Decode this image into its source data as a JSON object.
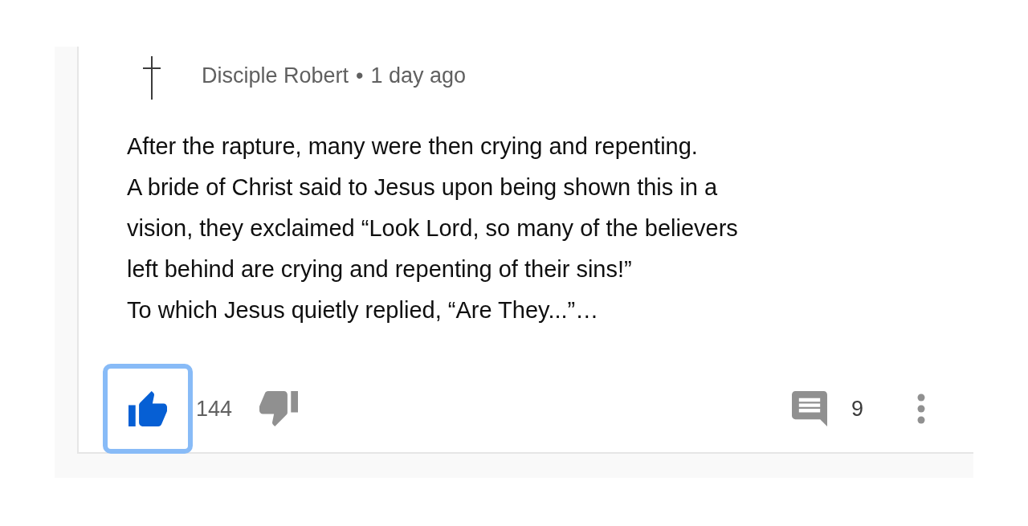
{
  "comment": {
    "author": "Disciple Robert",
    "separator": "•",
    "time": "1 day ago",
    "body_lines": [
      "After the rapture, many were then crying and repenting.",
      "A bride of Christ said to Jesus upon being shown this in a",
      "vision, they exclaimed “Look Lord, so many of the believers",
      "left behind are crying and repenting of their sins!”",
      "To which Jesus quietly replied, “Are They...”…"
    ],
    "like": {
      "selected": true,
      "focused": true,
      "count": "144"
    },
    "dislike": {
      "selected": false
    },
    "replies": {
      "count": "9"
    }
  }
}
